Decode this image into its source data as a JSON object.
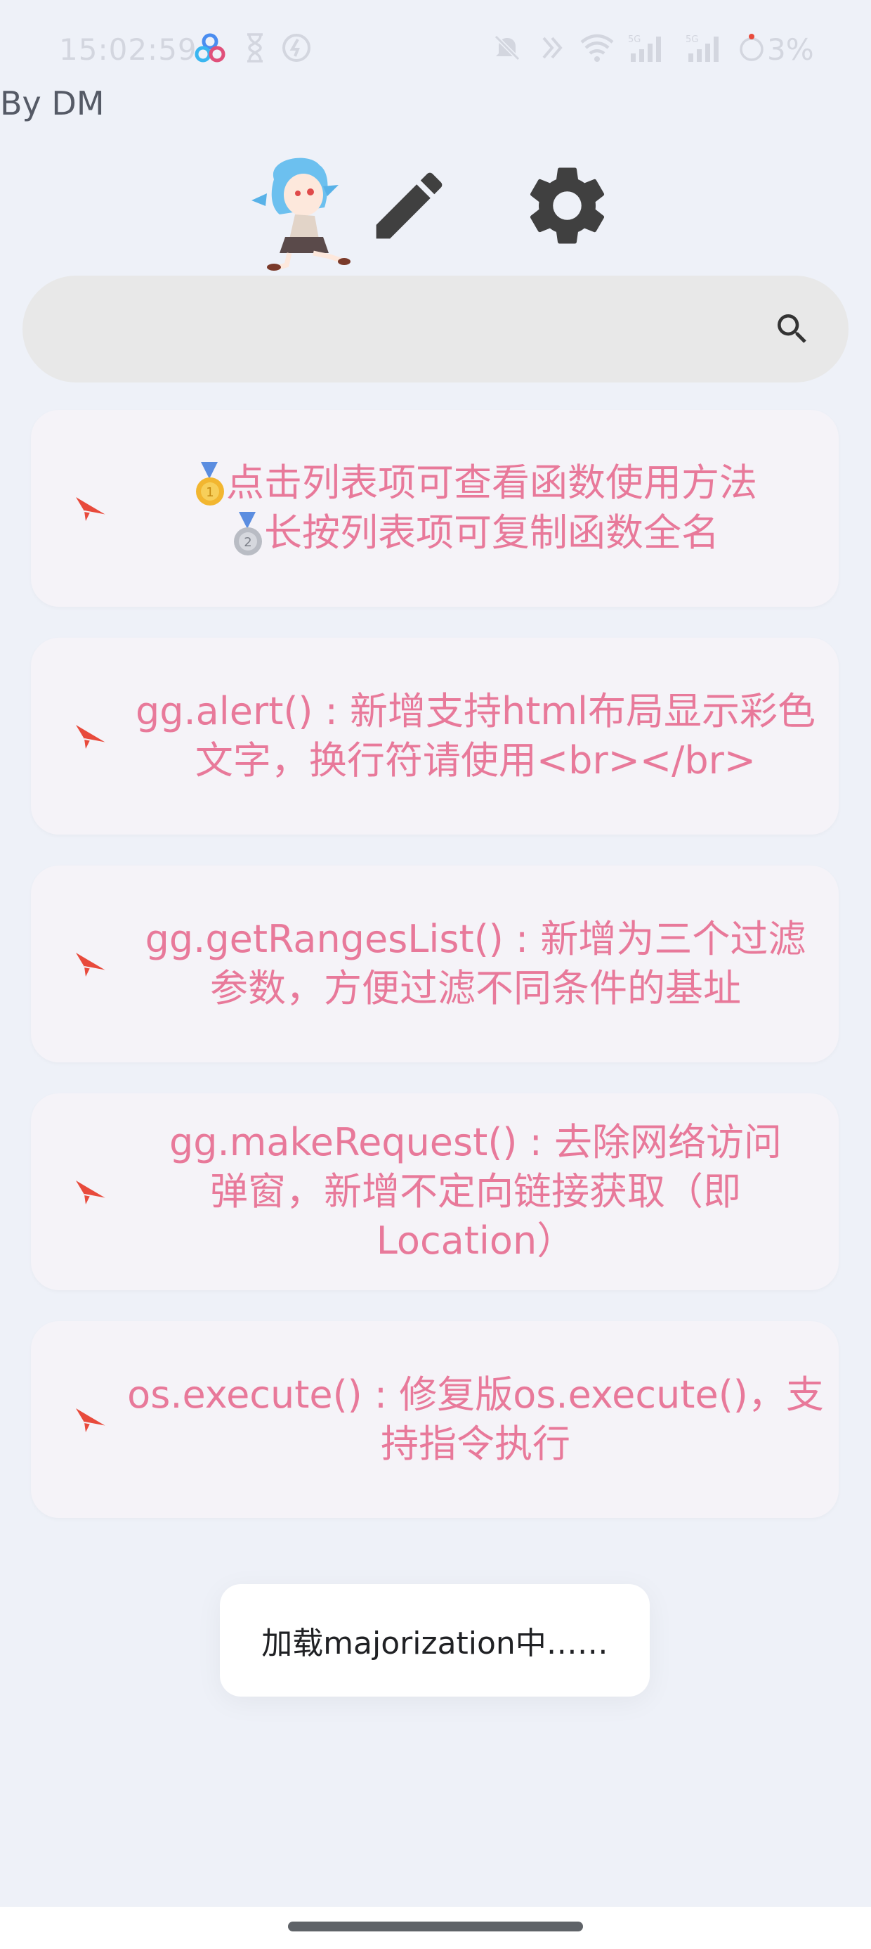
{
  "status_bar": {
    "time": "15:02:59",
    "battery": "3%",
    "icons": [
      "app-cluster-icon",
      "hourglass-icon",
      "no-entry-icon",
      "mute-icon",
      "nfc-icon",
      "wifi-icon",
      "signal-5g-icon",
      "signal-5g-icon",
      "battery-icon"
    ]
  },
  "header": {
    "author": "By DM",
    "icons": [
      "avatar-character",
      "pencil-icon",
      "gear-icon"
    ]
  },
  "search": {
    "placeholder": "",
    "value": "",
    "icon": "search-icon"
  },
  "cards": [
    {
      "lines": [
        "点击列表项可查看函数使用方法",
        "长按列表项可复制函数全名"
      ],
      "medals": [
        "gold",
        "silver"
      ]
    },
    {
      "lines": [
        "gg.alert() : 新增支持html布局显示彩色",
        "文字，换行符请使用<br></br>"
      ]
    },
    {
      "lines": [
        "gg.getRangesList() : 新增为三个过滤",
        "参数，方便过滤不同条件的基址"
      ]
    },
    {
      "lines": [
        "gg.makeRequest() : 去除网络访问",
        "弹窗，新增不定向链接获取（即",
        "Location）"
      ]
    },
    {
      "lines": [
        "os.execute() : 修复版os.execute()，支",
        "持指令执行"
      ]
    }
  ],
  "toast": {
    "message": "加载majorization中……"
  },
  "colors": {
    "background": "#eef1f8",
    "card": "#f5f3f8",
    "card_text": "#e8799a",
    "plane": "#e84a3c",
    "search_bg": "#e8e8e8"
  }
}
